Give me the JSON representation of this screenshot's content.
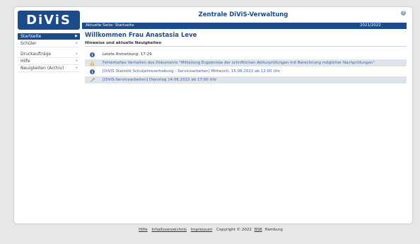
{
  "app": {
    "logo_text": "DiViS",
    "title": "Zentrale DiViS-Verwaltung"
  },
  "breadcrumb": {
    "label": "Aktuelle Seite:",
    "current": "Startseite",
    "school_year": "2021/2022"
  },
  "sidebar": {
    "items": [
      {
        "label": "Startseite",
        "active": true
      },
      {
        "label": "Schüler",
        "active": false
      },
      {
        "label": "Druckaufträge",
        "active": false
      },
      {
        "label": "Hilfe",
        "active": false
      },
      {
        "label": "Neuigkeiten (Archiv)",
        "active": false
      }
    ]
  },
  "main": {
    "title": "Willkommen Frau Anastasia Leve",
    "section_title": "Hinweise und aktuelle Neuigkeiten",
    "news": [
      {
        "icon": "info-icon",
        "text": "Letzte Anmeldung: 17:29",
        "link": false
      },
      {
        "icon": "warning-icon",
        "text": "Fehlerhaftes Verhalten des Dokuments \"Mitteilung Ergebnisse der schriftlichen Abiturprüfungen mit Berechnung möglicher Nachprüfungen\"",
        "link": true
      },
      {
        "icon": "info-icon",
        "text": "[DiViS Statistik Schuljahreserhebung - Servicearbeiten] Mittwoch, 15.06.2022 ab 12:00 Uhr",
        "link": true
      },
      {
        "icon": "wrench-icon",
        "text": "[DiViS-Servicearbeiten] Dienstag 14.06.2022 ab 17:00 Uhr",
        "link": true
      }
    ]
  },
  "footer": {
    "links": [
      "Hilfe",
      "Inhaltsverzeichnis",
      "Impressum"
    ],
    "copyright_prefix": "Copyright © 2022",
    "bsb": "BSB",
    "city": "Hamburg"
  },
  "colors": {
    "brand": "#1b4b8a",
    "link": "#3a66a8",
    "warning": "#e8b22a",
    "row_alt": "#dfe3ea"
  }
}
